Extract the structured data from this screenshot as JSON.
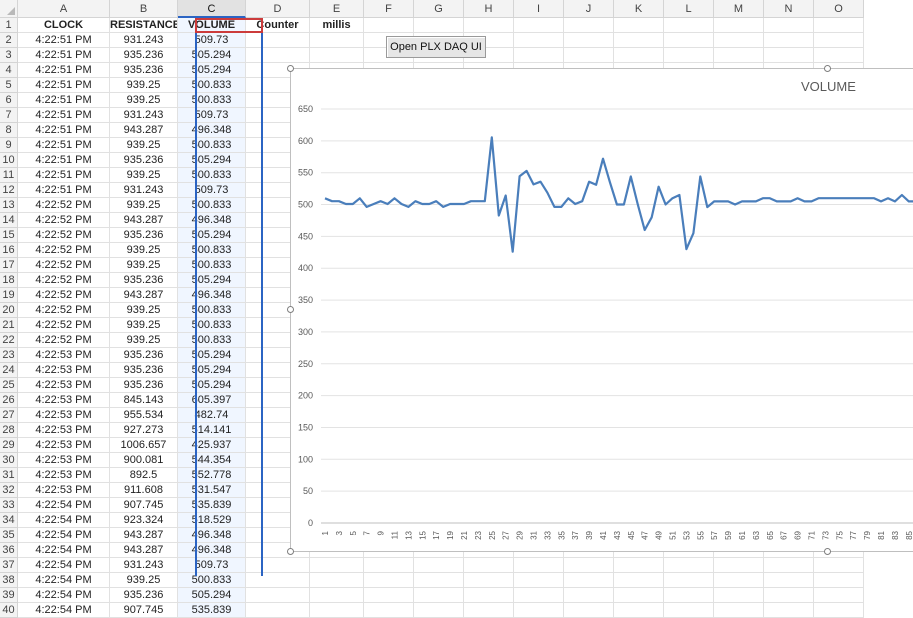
{
  "columns": [
    "A",
    "B",
    "C",
    "D",
    "E",
    "F",
    "G",
    "H",
    "I",
    "J",
    "K",
    "L",
    "M",
    "N",
    "O"
  ],
  "headers": {
    "A": "CLOCK",
    "B": "RESISTANCE",
    "C": "VOLUME",
    "D": "Counter",
    "E": "millis"
  },
  "rows": [
    [
      "4:22:51 PM",
      "931.243",
      "509.73"
    ],
    [
      "4:22:51 PM",
      "935.236",
      "505.294"
    ],
    [
      "4:22:51 PM",
      "935.236",
      "505.294"
    ],
    [
      "4:22:51 PM",
      "939.25",
      "500.833"
    ],
    [
      "4:22:51 PM",
      "939.25",
      "500.833"
    ],
    [
      "4:22:51 PM",
      "931.243",
      "509.73"
    ],
    [
      "4:22:51 PM",
      "943.287",
      "496.348"
    ],
    [
      "4:22:51 PM",
      "939.25",
      "500.833"
    ],
    [
      "4:22:51 PM",
      "935.236",
      "505.294"
    ],
    [
      "4:22:51 PM",
      "939.25",
      "500.833"
    ],
    [
      "4:22:51 PM",
      "931.243",
      "509.73"
    ],
    [
      "4:22:52 PM",
      "939.25",
      "500.833"
    ],
    [
      "4:22:52 PM",
      "943.287",
      "496.348"
    ],
    [
      "4:22:52 PM",
      "935.236",
      "505.294"
    ],
    [
      "4:22:52 PM",
      "939.25",
      "500.833"
    ],
    [
      "4:22:52 PM",
      "939.25",
      "500.833"
    ],
    [
      "4:22:52 PM",
      "935.236",
      "505.294"
    ],
    [
      "4:22:52 PM",
      "943.287",
      "496.348"
    ],
    [
      "4:22:52 PM",
      "939.25",
      "500.833"
    ],
    [
      "4:22:52 PM",
      "939.25",
      "500.833"
    ],
    [
      "4:22:52 PM",
      "939.25",
      "500.833"
    ],
    [
      "4:22:53 PM",
      "935.236",
      "505.294"
    ],
    [
      "4:22:53 PM",
      "935.236",
      "505.294"
    ],
    [
      "4:22:53 PM",
      "935.236",
      "505.294"
    ],
    [
      "4:22:53 PM",
      "845.143",
      "605.397"
    ],
    [
      "4:22:53 PM",
      "955.534",
      "482.74"
    ],
    [
      "4:22:53 PM",
      "927.273",
      "514.141"
    ],
    [
      "4:22:53 PM",
      "1006.657",
      "425.937"
    ],
    [
      "4:22:53 PM",
      "900.081",
      "544.354"
    ],
    [
      "4:22:53 PM",
      "892.5",
      "552.778"
    ],
    [
      "4:22:53 PM",
      "911.608",
      "531.547"
    ],
    [
      "4:22:54 PM",
      "907.745",
      "535.839"
    ],
    [
      "4:22:54 PM",
      "923.324",
      "518.529"
    ],
    [
      "4:22:54 PM",
      "943.287",
      "496.348"
    ],
    [
      "4:22:54 PM",
      "943.287",
      "496.348"
    ],
    [
      "4:22:54 PM",
      "931.243",
      "509.73"
    ],
    [
      "4:22:54 PM",
      "939.25",
      "500.833"
    ],
    [
      "4:22:54 PM",
      "935.236",
      "505.294"
    ],
    [
      "4:22:54 PM",
      "907.745",
      "535.839"
    ]
  ],
  "button_label": "Open PLX DAQ UI",
  "accent": "#4a7ebb",
  "chart_data": {
    "type": "line",
    "title": "VOLUME",
    "ylim": [
      0,
      650
    ],
    "yticks": [
      "0",
      "50",
      "100",
      "150",
      "200",
      "250",
      "300",
      "350",
      "400",
      "450",
      "500",
      "550",
      "600",
      "650"
    ],
    "xticks": [
      "1",
      "3",
      "5",
      "7",
      "9",
      "11",
      "13",
      "15",
      "17",
      "19",
      "21",
      "23",
      "25",
      "27",
      "29",
      "31",
      "33",
      "35",
      "37",
      "39",
      "41",
      "43",
      "45",
      "47",
      "49",
      "51",
      "53",
      "55",
      "57",
      "59",
      "61",
      "63",
      "65",
      "67",
      "69",
      "71",
      "73",
      "75",
      "77",
      "79",
      "81",
      "83",
      "85"
    ],
    "series": [
      {
        "values": [
          509.73,
          505.294,
          505.294,
          500.833,
          500.833,
          509.73,
          496.348,
          500.833,
          505.294,
          500.833,
          509.73,
          500.833,
          496.348,
          505.294,
          500.833,
          500.833,
          505.294,
          496.348,
          500.833,
          500.833,
          500.833,
          505.294,
          505.294,
          505.294,
          605.397,
          482.74,
          514.141,
          425.937,
          544.354,
          552.778,
          531.547,
          535.839,
          518.529,
          496.348,
          496.348,
          509.73,
          500.833,
          505.294,
          535.839,
          531,
          572,
          535,
          500,
          500,
          544,
          500,
          460,
          480,
          528,
          500,
          510,
          515,
          430,
          455,
          544,
          496,
          505,
          505,
          505,
          500,
          505,
          505,
          505,
          510,
          510,
          505,
          505,
          505,
          510,
          505,
          505,
          510,
          510,
          510,
          510,
          510,
          510,
          510,
          510,
          510,
          505,
          510,
          505,
          515,
          505,
          505
        ]
      }
    ]
  }
}
